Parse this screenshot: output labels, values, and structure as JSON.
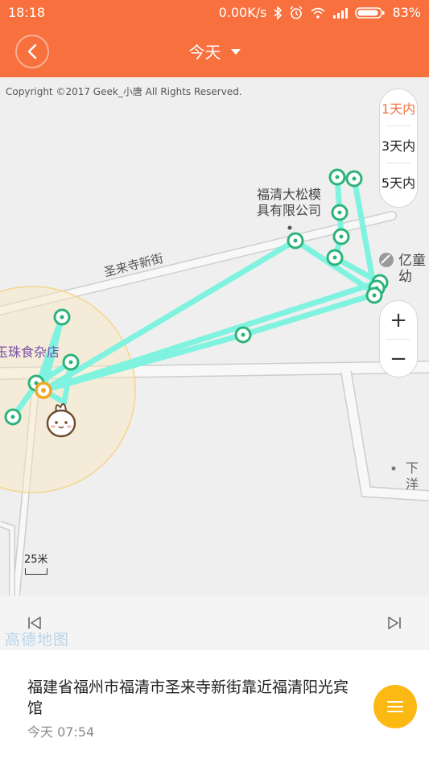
{
  "status_bar": {
    "time": "18:18",
    "network_speed": "0.00K/s",
    "battery": "83%",
    "icons": [
      "bluetooth-icon",
      "alarm-icon",
      "wifi-icon",
      "signal-icon",
      "battery-icon"
    ]
  },
  "header": {
    "title": "今天",
    "back_icon": "chevron-left-icon",
    "dropdown_icon": "caret-down-icon",
    "background_color": "#f7703e"
  },
  "map": {
    "copyright": "Copyright ©2017 Geek_小唐 All Rights Reserved.",
    "labels": {
      "poi_company_line1": "福清大松模",
      "poi_company_line2": "具有限公司",
      "poi_store": "玉珠食杂店",
      "poi_right_top": "亿童幼",
      "poi_right_bottom": "下洋",
      "street": "圣来寺新街"
    },
    "day_filter": {
      "options": [
        "1天内",
        "3天内",
        "5天内"
      ],
      "selected": "1天内"
    },
    "zoom_in": "+",
    "zoom_out": "−",
    "scale": "25米",
    "track_color": "#7ff3e0",
    "point_color": "#2cb37a",
    "current_point_color": "#f5a623"
  },
  "playback": {
    "prev_icon": "step-back-icon",
    "next_icon": "step-forward-icon",
    "provider": "高德地图"
  },
  "info": {
    "address": "福建省福州市福清市圣来寺新街靠近福清阳光宾馆",
    "time": "今天 07:54",
    "menu_icon": "menu-icon",
    "fab_color": "#fdb913"
  }
}
